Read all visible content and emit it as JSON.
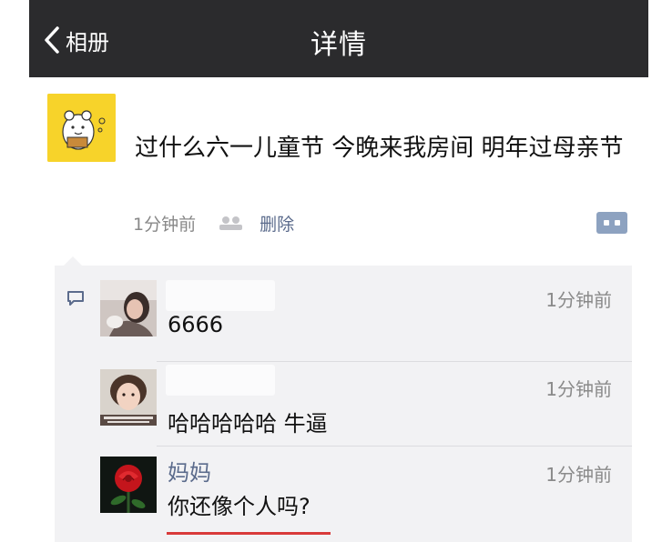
{
  "navbar": {
    "back_label": "相册",
    "title": "详情"
  },
  "post": {
    "text": "过什么六一儿童节 今晚来我房间 明年过母亲节",
    "time": "1分钟前",
    "delete_label": "删除"
  },
  "comments": [
    {
      "name": "",
      "text": "6666",
      "time": "1分钟前"
    },
    {
      "name": "",
      "text": "哈哈哈哈哈 牛逼",
      "time": "1分钟前"
    },
    {
      "name": "妈妈",
      "text": "你还像个人吗?",
      "time": "1分钟前"
    }
  ],
  "colors": {
    "navbar_bg": "#2b2b2d",
    "link_blue": "#5b6b8c",
    "panel_bg": "#f2f2f4",
    "avatar_yellow": "#f7d32a"
  }
}
